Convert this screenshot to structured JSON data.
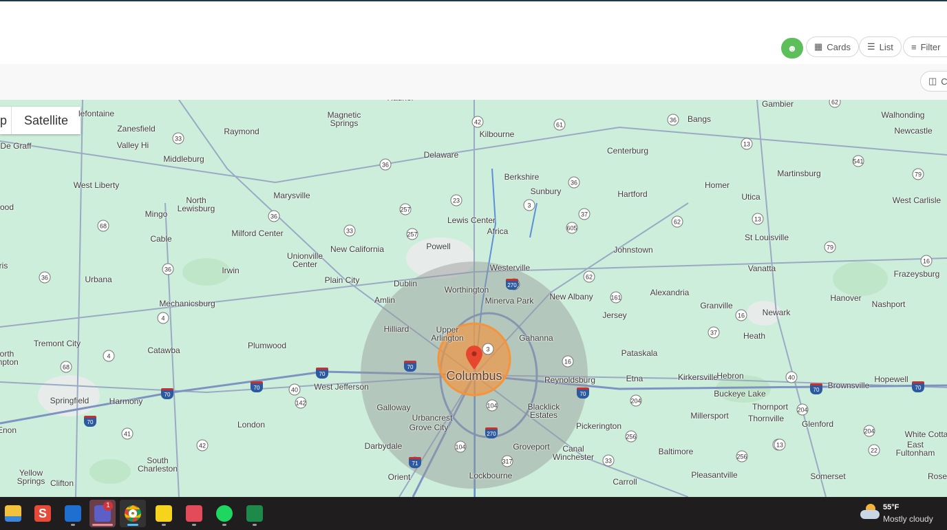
{
  "toolbar": {
    "cards_label": "Cards",
    "list_label": "List",
    "filter_label": "Filter",
    "columns_label": "Co"
  },
  "map": {
    "map_type_partial": "p",
    "satellite_label": "Satellite",
    "center_city": "Columbus",
    "towns": [
      "lefontaine",
      "Zanesfield",
      "Magnetic\nSprings",
      "Raymond",
      "Kilbourne",
      "Delaware",
      "Gambier",
      "Bangs",
      "Walhonding",
      "Newcastle",
      "De Graff",
      "Valley Hi",
      "Middleburg",
      "Centerburg",
      "Martinsburg",
      "Berkshire",
      "West Liberty",
      "Marysville",
      "Sunbury",
      "Hartford",
      "Homer",
      "Utica",
      "West Carlisle",
      "North\nLewisburg",
      "Mingo",
      "Lewis Center",
      "Africa",
      "Milford Center",
      "Cable",
      "Johnstown",
      "St Louisville",
      "New California",
      "Powell",
      "Unionville\nCenter",
      "Westerville",
      "Vanatta",
      "Frazeysburg",
      "Irwin",
      "Urbana",
      "Plain City",
      "Dublin",
      "Worthington",
      "Alexandria",
      "New Albany",
      "Minerva Park",
      "Granville",
      "Hanover",
      "Nashport",
      "Mechanicsburg",
      "Amlin",
      "Jersey",
      "Newark",
      "Hilliard",
      "Upper\nArlington",
      "Gahanna",
      "Heath",
      "Tremont City",
      "Catawba",
      "Plumwood",
      "Pataskala",
      "Reynoldsburg",
      "Etna",
      "Kirkersville",
      "Hebron",
      "Hopewell",
      "Brownsville",
      "West Jefferson",
      "Springfield",
      "Harmony",
      "Buckeye Lake",
      "Galloway",
      "Blacklick\nEstates",
      "Millersport",
      "Thornport",
      "Thornville",
      "Glenford",
      "London",
      "Urbancrest",
      "Grove City",
      "Pickerington",
      "White Cotta",
      "Darbydale",
      "Groveport",
      "Canal\nWinchester",
      "Baltimore",
      "East\nFultonham",
      "South\nCharleston",
      "Yellow\nSprings",
      "Clifton",
      "Orient",
      "Lockbourne",
      "Carroll",
      "Pleasantville",
      "Somerset",
      "Rosev",
      "Enon",
      "orth\nmpton",
      "ood",
      "ris",
      "Radnor"
    ],
    "routes": [
      "42",
      "61",
      "36",
      "13",
      "62",
      "33",
      "36",
      "257",
      "23",
      "36",
      "3",
      "37",
      "541",
      "79",
      "33",
      "68",
      "36",
      "605",
      "62",
      "13",
      "257",
      "79",
      "36",
      "36",
      "270",
      "62",
      "161",
      "16",
      "4",
      "16",
      "37",
      "4",
      "68",
      "16",
      "40",
      "104",
      "256",
      "33",
      "317",
      "204",
      "204",
      "13",
      "256",
      "22",
      "41",
      "42",
      "142",
      "104",
      "3",
      "40",
      "71",
      "13",
      "204"
    ],
    "interstates": [
      "70",
      "70",
      "70",
      "70",
      "70",
      "70",
      "70",
      "270",
      "270",
      "71",
      "70"
    ]
  },
  "taskbar": {
    "teams_badge": "1",
    "weather_temp": "55°F",
    "weather_desc": "Mostly cloudy"
  },
  "colors": {
    "accent_green": "#5cbf5a",
    "radius_orange": "#f5943a",
    "pin": "#e8472f"
  }
}
